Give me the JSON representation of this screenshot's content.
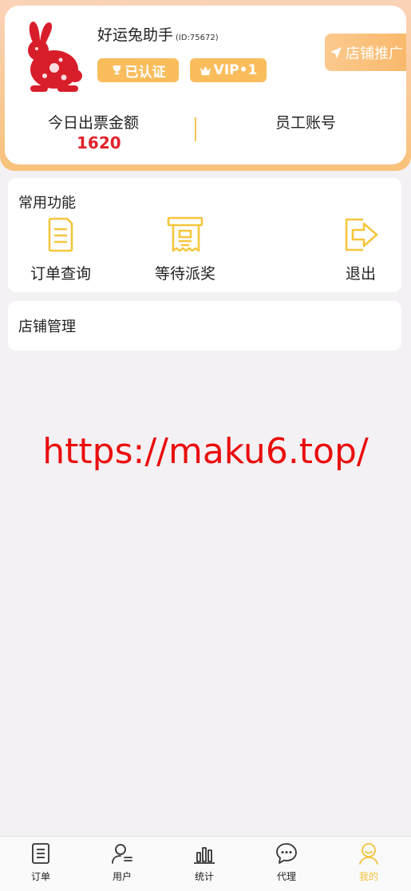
{
  "profile": {
    "name": "好运兔助手",
    "id_text": "(ID:75672)",
    "badge_certified": "已认证",
    "badge_vip": "VIP•1",
    "promo_button": "店铺推广",
    "stats": {
      "amount_label": "今日出票金额",
      "amount_value": "1620",
      "staff_label": "员工账号"
    },
    "colors": {
      "accent": "#f9bd5c",
      "amount": "#e0222b"
    }
  },
  "common_functions": {
    "title": "常用功能",
    "items": [
      {
        "label": "订单查询",
        "icon": "document-icon"
      },
      {
        "label": "等待派奖",
        "icon": "receipt-icon"
      },
      {
        "label": "退出",
        "icon": "exit-icon"
      }
    ]
  },
  "shop_management": {
    "title": "店铺管理"
  },
  "watermark": "https://maku6.top/",
  "tabbar": {
    "items": [
      {
        "label": "订单",
        "icon": "order-icon",
        "active": false
      },
      {
        "label": "用户",
        "icon": "user-icon",
        "active": false
      },
      {
        "label": "统计",
        "icon": "chart-icon",
        "active": false
      },
      {
        "label": "代理",
        "icon": "chat-icon",
        "active": false
      },
      {
        "label": "我的",
        "icon": "profile-icon",
        "active": true
      }
    ],
    "active_color": "#f2c23a"
  }
}
